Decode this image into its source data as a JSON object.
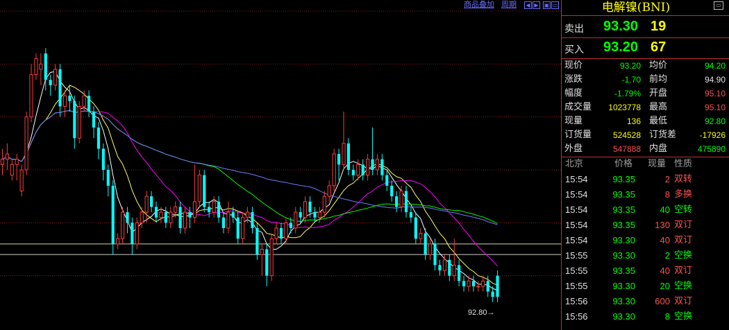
{
  "toolbar": {
    "overlay_label": "商品叠加",
    "period_label": "周期",
    "btn_left": "◀",
    "btn_right": "▶",
    "btn_dock": "▣",
    "btn_dock2": "▭"
  },
  "panel": {
    "symbol": "电解镍(BNI)",
    "corner_icon": "▭",
    "ask": {
      "label": "卖出",
      "price": "93.30",
      "volume": "19"
    },
    "bid": {
      "label": "买入",
      "price": "93.20",
      "volume": "67"
    },
    "stats": [
      {
        "l1": "现价",
        "v1": "93.20",
        "c1": "#00ff00",
        "l2": "均价",
        "v2": "94.20",
        "c2": "#00ff00"
      },
      {
        "l1": "涨跌",
        "v1": "-1.70",
        "c1": "#00ff00",
        "l2": "前均",
        "v2": "94.90",
        "c2": "#e0e0e0"
      },
      {
        "l1": "幅度",
        "v1": "-1.79%",
        "c1": "#00ff00",
        "l2": "开盘",
        "v2": "95.10",
        "c2": "#ff5050"
      },
      {
        "l1": "成交量",
        "v1": "1023778",
        "c1": "#ffff00",
        "l2": "最高",
        "v2": "95.10",
        "c2": "#ff5050"
      },
      {
        "l1": "现量",
        "v1": "136",
        "c1": "#ffff00",
        "l2": "最低",
        "v2": "92.80",
        "c2": "#00ff00"
      },
      {
        "l1": "订货量",
        "v1": "524528",
        "c1": "#ffff00",
        "l2": "订货差",
        "v2": "-17926",
        "c2": "#ffff00"
      },
      {
        "l1": "外盘",
        "v1": "547888",
        "c1": "#ff5050",
        "l2": "内盘",
        "v2": "475890",
        "c2": "#00ff00"
      }
    ],
    "trades_header": {
      "time": "北京",
      "price": "价格",
      "volume": "现量",
      "nature": "性质"
    },
    "trades": [
      {
        "time": "15:54",
        "price": "93.35",
        "volume": "2",
        "nature": "双转"
      },
      {
        "time": "15:54",
        "price": "93.35",
        "volume": "8",
        "nature": "多换"
      },
      {
        "time": "15:54",
        "price": "93.35",
        "volume": "40",
        "nature": "空转"
      },
      {
        "time": "15:54",
        "price": "93.35",
        "volume": "130",
        "nature": "双订"
      },
      {
        "time": "15:54",
        "price": "93.30",
        "volume": "40",
        "nature": "双订"
      },
      {
        "time": "15:55",
        "price": "93.30",
        "volume": "2",
        "nature": "空换"
      },
      {
        "time": "15:55",
        "price": "93.35",
        "volume": "40",
        "nature": "双订"
      },
      {
        "time": "15:55",
        "price": "93.30",
        "volume": "20",
        "nature": "空换"
      },
      {
        "time": "15:56",
        "price": "93.30",
        "volume": "600",
        "nature": "双订"
      },
      {
        "time": "15:56",
        "price": "93.30",
        "volume": "8",
        "nature": "空换"
      }
    ]
  },
  "colors": {
    "up": "#ff3c3c",
    "down": "#00ffff",
    "green": "#00ff00",
    "yellow": "#ffff00",
    "white": "#e0e0e0"
  },
  "chart_data": {
    "type": "candlestick",
    "last_price_label": "92.80→",
    "ylim": [
      92.5,
      95.5
    ],
    "reference_lines": [
      93.3,
      93.2
    ],
    "grid": "dotted red horizontal",
    "candles": [
      [
        94.05,
        94.1,
        93.95,
        94.2
      ],
      [
        94.1,
        94.15,
        94.0,
        94.25
      ],
      [
        93.95,
        94.05,
        93.9,
        94.1
      ],
      [
        94.05,
        94.1,
        93.9,
        94.15
      ],
      [
        93.8,
        94.0,
        93.75,
        94.05
      ],
      [
        94.0,
        94.5,
        93.95,
        94.55
      ],
      [
        94.5,
        94.9,
        94.45,
        95.0
      ],
      [
        94.9,
        95.05,
        94.85,
        95.1
      ],
      [
        94.95,
        95.0,
        94.8,
        95.1
      ],
      [
        95.1,
        94.85,
        94.75,
        95.15
      ],
      [
        94.85,
        94.8,
        94.7,
        94.9
      ],
      [
        94.8,
        94.95,
        94.75,
        95.0
      ],
      [
        94.95,
        94.6,
        94.5,
        95.0
      ],
      [
        94.6,
        94.7,
        94.5,
        94.75
      ],
      [
        94.7,
        94.65,
        94.55,
        94.8
      ],
      [
        94.65,
        94.3,
        94.2,
        94.7
      ],
      [
        94.3,
        94.6,
        94.25,
        94.65
      ],
      [
        94.6,
        94.7,
        94.55,
        94.75
      ],
      [
        94.7,
        94.55,
        94.5,
        94.75
      ],
      [
        94.55,
        94.4,
        94.3,
        94.6
      ],
      [
        94.4,
        94.2,
        94.1,
        94.45
      ],
      [
        94.2,
        94.0,
        93.9,
        94.25
      ],
      [
        94.0,
        93.85,
        93.75,
        94.05
      ],
      [
        93.85,
        93.3,
        93.2,
        93.9
      ],
      [
        93.3,
        93.35,
        93.25,
        93.4
      ],
      [
        93.35,
        93.6,
        93.3,
        93.65
      ],
      [
        93.6,
        93.5,
        93.4,
        93.65
      ],
      [
        93.5,
        93.3,
        93.2,
        93.55
      ],
      [
        93.3,
        93.5,
        93.25,
        93.55
      ],
      [
        93.5,
        93.6,
        93.45,
        93.65
      ],
      [
        93.6,
        93.75,
        93.5,
        93.8
      ],
      [
        93.75,
        93.65,
        93.6,
        93.8
      ],
      [
        93.65,
        93.55,
        93.5,
        93.7
      ],
      [
        93.55,
        93.6,
        93.5,
        93.65
      ],
      [
        93.6,
        93.5,
        93.45,
        93.65
      ],
      [
        93.5,
        93.6,
        93.45,
        93.65
      ],
      [
        93.6,
        93.65,
        93.55,
        93.7
      ],
      [
        93.65,
        93.45,
        93.4,
        93.7
      ],
      [
        93.45,
        93.6,
        93.4,
        93.65
      ],
      [
        93.6,
        93.55,
        93.45,
        93.65
      ],
      [
        93.55,
        93.7,
        93.5,
        94.05
      ],
      [
        93.7,
        93.95,
        93.65,
        94.0
      ],
      [
        93.95,
        93.65,
        93.6,
        94.0
      ],
      [
        93.65,
        93.6,
        93.55,
        93.7
      ],
      [
        93.6,
        93.7,
        93.55,
        93.75
      ],
      [
        93.7,
        93.55,
        93.5,
        93.75
      ],
      [
        93.55,
        93.45,
        93.4,
        93.6
      ],
      [
        93.45,
        93.6,
        93.4,
        93.7
      ],
      [
        93.6,
        93.55,
        93.5,
        93.65
      ],
      [
        93.55,
        93.35,
        93.3,
        93.6
      ],
      [
        93.35,
        93.55,
        93.3,
        93.6
      ],
      [
        93.55,
        93.6,
        93.5,
        93.65
      ],
      [
        93.6,
        93.45,
        93.4,
        93.65
      ],
      [
        93.45,
        93.2,
        93.15,
        93.5
      ],
      [
        93.2,
        93.25,
        93.0,
        93.3
      ],
      [
        93.25,
        93.0,
        92.9,
        93.3
      ],
      [
        93.0,
        93.35,
        92.95,
        93.4
      ],
      [
        93.35,
        93.45,
        93.3,
        93.5
      ],
      [
        93.45,
        93.35,
        93.3,
        93.5
      ],
      [
        93.35,
        93.5,
        93.3,
        93.55
      ],
      [
        93.5,
        93.45,
        93.4,
        93.55
      ],
      [
        93.45,
        93.6,
        93.4,
        93.65
      ],
      [
        93.6,
        93.55,
        93.5,
        93.65
      ],
      [
        93.55,
        93.7,
        93.5,
        93.75
      ],
      [
        93.7,
        93.6,
        93.55,
        93.75
      ],
      [
        93.6,
        93.55,
        93.5,
        93.65
      ],
      [
        93.55,
        93.6,
        93.5,
        93.65
      ],
      [
        93.6,
        93.75,
        93.55,
        93.8
      ],
      [
        93.75,
        93.85,
        93.7,
        93.9
      ],
      [
        93.85,
        94.15,
        93.8,
        94.2
      ],
      [
        94.15,
        94.05,
        93.9,
        94.2
      ],
      [
        94.05,
        94.25,
        94.0,
        94.55
      ],
      [
        94.25,
        94.0,
        93.95,
        94.3
      ],
      [
        94.0,
        93.95,
        93.9,
        94.05
      ],
      [
        93.95,
        94.05,
        93.9,
        94.1
      ],
      [
        94.05,
        93.95,
        93.9,
        94.1
      ],
      [
        93.95,
        94.1,
        93.9,
        94.15
      ],
      [
        94.1,
        94.0,
        93.95,
        94.4
      ],
      [
        94.0,
        94.1,
        93.95,
        94.15
      ],
      [
        94.1,
        93.95,
        93.9,
        94.15
      ],
      [
        93.95,
        93.85,
        93.8,
        94.0
      ],
      [
        93.85,
        93.75,
        93.7,
        93.9
      ],
      [
        93.75,
        93.65,
        93.6,
        93.8
      ],
      [
        93.65,
        93.8,
        93.6,
        93.85
      ],
      [
        93.8,
        93.6,
        93.55,
        93.85
      ],
      [
        93.6,
        93.55,
        93.5,
        93.65
      ],
      [
        93.55,
        93.35,
        93.3,
        93.6
      ],
      [
        93.35,
        93.4,
        93.3,
        93.45
      ],
      [
        93.4,
        93.2,
        93.15,
        93.45
      ],
      [
        93.2,
        93.3,
        93.15,
        93.35
      ],
      [
        93.3,
        93.1,
        93.05,
        93.35
      ],
      [
        93.1,
        93.05,
        93.0,
        93.15
      ],
      [
        93.05,
        93.15,
        93.0,
        93.2
      ],
      [
        93.15,
        93.0,
        92.95,
        93.2
      ],
      [
        93.0,
        93.1,
        92.95,
        93.35
      ],
      [
        93.1,
        92.95,
        92.9,
        93.15
      ],
      [
        92.95,
        92.9,
        92.85,
        93.0
      ],
      [
        92.9,
        92.95,
        92.85,
        93.0
      ],
      [
        92.95,
        92.9,
        92.85,
        93.0
      ],
      [
        92.9,
        92.9,
        92.85,
        92.95
      ],
      [
        92.9,
        92.95,
        92.85,
        93.0
      ],
      [
        92.95,
        92.85,
        92.8,
        93.0
      ],
      [
        92.85,
        92.8,
        92.75,
        92.9
      ],
      [
        93.0,
        92.8,
        92.75,
        93.05
      ]
    ],
    "ma_series": [
      {
        "color": "#ffffff",
        "period": 5
      },
      {
        "color": "#ffff66",
        "period": 10
      },
      {
        "color": "#ff00ff",
        "period": 20
      },
      {
        "color": "#00ff00",
        "period": 40
      },
      {
        "color": "#6b7bff",
        "period": 60
      }
    ]
  }
}
